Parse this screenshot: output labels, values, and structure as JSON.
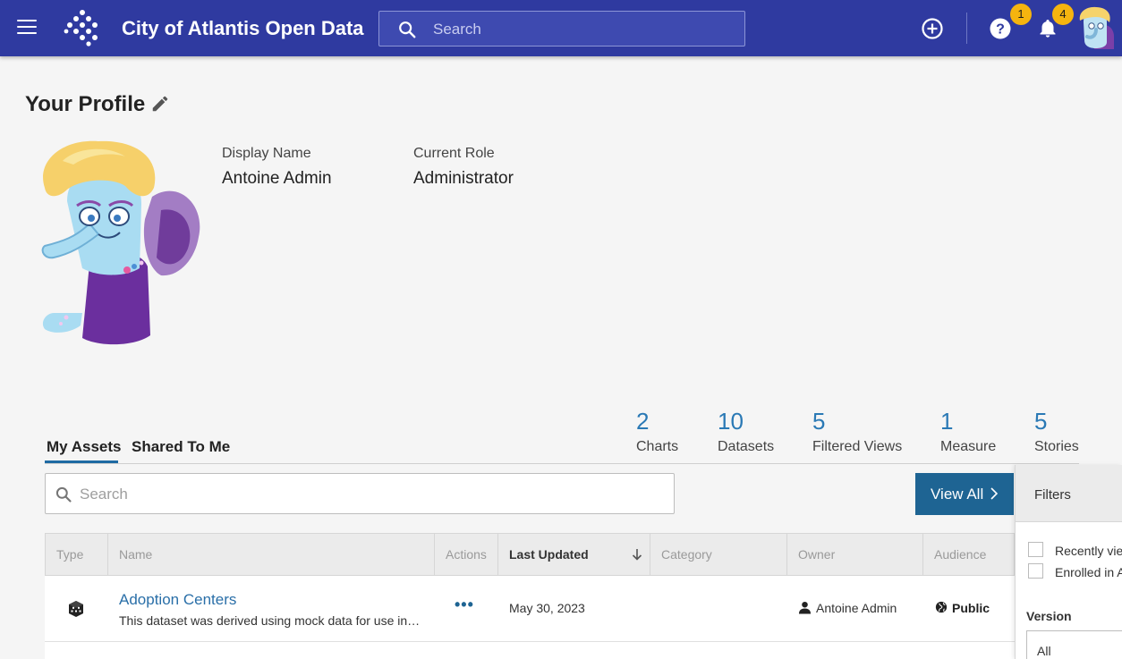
{
  "header": {
    "app_title": "City of Atlantis Open Data",
    "search_placeholder": "Search",
    "help_badge": "1",
    "notifications_badge": "4",
    "icons": [
      "menu-icon",
      "logo-icon",
      "search-icon",
      "add-icon",
      "help-icon",
      "bell-icon",
      "avatar"
    ]
  },
  "profile": {
    "title": "Your Profile",
    "display_name_label": "Display Name",
    "display_name": "Antoine Admin",
    "role_label": "Current Role",
    "role": "Administrator"
  },
  "tabs": [
    {
      "label": "My Assets",
      "active": true
    },
    {
      "label": "Shared To Me",
      "active": false
    }
  ],
  "counts": [
    {
      "value": "2",
      "label": "Charts"
    },
    {
      "value": "10",
      "label": "Datasets"
    },
    {
      "value": "5",
      "label": "Filtered Views"
    },
    {
      "value": "1",
      "label": "Measure"
    },
    {
      "value": "5",
      "label": "Stories"
    }
  ],
  "assets": {
    "search_placeholder": "Search",
    "view_all_label": "View All",
    "columns": [
      "Type",
      "Name",
      "Actions",
      "Last Updated",
      "Category",
      "Owner",
      "Audience"
    ],
    "sorted_column": "Last Updated",
    "rows": [
      {
        "type_icon": "dataset-icon",
        "name": "Adoption Centers",
        "description": "This dataset was derived using mock data for use in…",
        "actions": "•••",
        "last_updated": "May 30, 2023",
        "category": "",
        "owner": "Antoine Admin",
        "audience": "Public"
      }
    ]
  },
  "filters": {
    "title": "Filters",
    "options": [
      "Recently vie",
      "Enrolled in A"
    ],
    "version_label": "Version",
    "version_value": "All"
  },
  "colors": {
    "header_bg": "#2f3aa0",
    "badge": "#f5b40f",
    "accent_blue": "#2a79b5",
    "button_bg": "#1e6493"
  }
}
